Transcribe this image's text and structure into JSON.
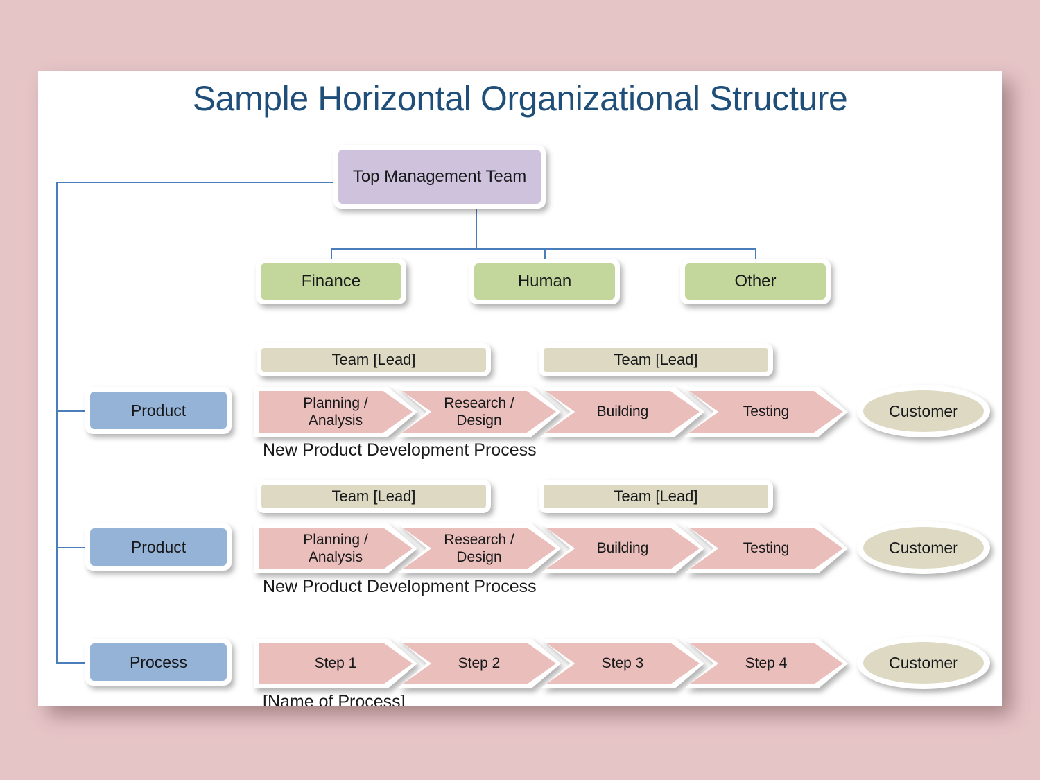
{
  "slide": {
    "title": "Sample Horizontal Organizational Structure",
    "background_color": "#e6c5c7",
    "canvas_color": "#ffffff",
    "title_color": "#1f4e79",
    "connector_color": "#4a7ebb"
  },
  "top_node": {
    "label": "Top Management Team",
    "color": "#cfc2dd"
  },
  "functions": {
    "color": "#c3d69b",
    "items": [
      {
        "label": "Finance"
      },
      {
        "label": "Human"
      },
      {
        "label": "Other"
      }
    ]
  },
  "rows": [
    {
      "owner": "Product",
      "owner_color": "#95b3d7",
      "teams": [
        {
          "label": "Team [Lead]"
        },
        {
          "label": "Team [Lead]"
        }
      ],
      "team_color": "#ddd9c3",
      "steps": [
        {
          "label": "Planning /\nAnalysis"
        },
        {
          "label": "Research /\nDesign"
        },
        {
          "label": "Building"
        },
        {
          "label": "Testing"
        }
      ],
      "step_color": "#eabebb",
      "caption": "New Product Development Process",
      "customer": "Customer",
      "customer_color": "#ddd9c3"
    },
    {
      "owner": "Product",
      "owner_color": "#95b3d7",
      "teams": [
        {
          "label": "Team [Lead]"
        },
        {
          "label": "Team [Lead]"
        }
      ],
      "team_color": "#ddd9c3",
      "steps": [
        {
          "label": "Planning /\nAnalysis"
        },
        {
          "label": "Research /\nDesign"
        },
        {
          "label": "Building"
        },
        {
          "label": "Testing"
        }
      ],
      "step_color": "#eabebb",
      "caption": "New Product Development Process",
      "customer": "Customer",
      "customer_color": "#ddd9c3"
    },
    {
      "owner": "Process",
      "owner_color": "#95b3d7",
      "teams": [],
      "team_color": "#ddd9c3",
      "steps": [
        {
          "label": "Step 1"
        },
        {
          "label": "Step 2"
        },
        {
          "label": "Step 3"
        },
        {
          "label": "Step 4"
        }
      ],
      "step_color": "#eabebb",
      "caption": "[Name of Process]",
      "customer": "Customer",
      "customer_color": "#ddd9c3"
    }
  ]
}
